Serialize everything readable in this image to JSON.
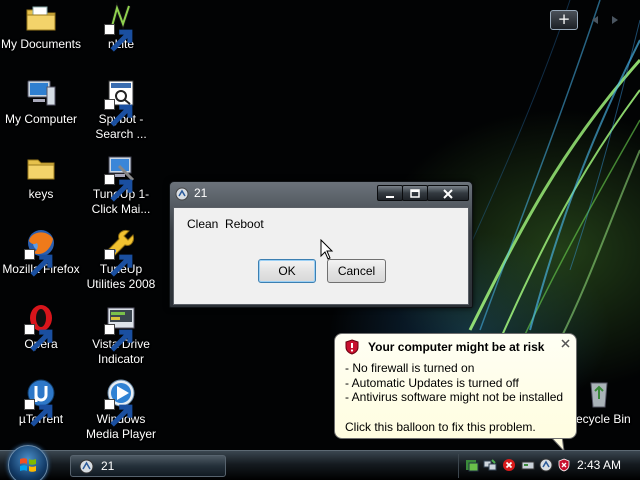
{
  "desktop": {
    "icons": [
      {
        "label": "My Documents",
        "icon": "folder-documents-icon"
      },
      {
        "label": "nLite",
        "icon": "nlite-icon",
        "shortcut": true
      },
      {
        "label": "My Computer",
        "icon": "computer-icon"
      },
      {
        "label": "Spybot - Search ...",
        "icon": "spybot-icon",
        "shortcut": true
      },
      {
        "label": "keys",
        "icon": "folder-icon"
      },
      {
        "label": "TuneUp 1-Click Mai...",
        "icon": "tuneup-1click-icon",
        "shortcut": true
      },
      {
        "label": "Mozilla Firefox",
        "icon": "firefox-icon",
        "shortcut": true
      },
      {
        "label": "TuneUp Utilities 2008",
        "icon": "tuneup-utilities-icon",
        "shortcut": true
      },
      {
        "label": "Opera",
        "icon": "opera-icon",
        "shortcut": true
      },
      {
        "label": "Vista Drive Indicator",
        "icon": "drive-indicator-icon",
        "shortcut": true
      },
      {
        "label": "µTorrent",
        "icon": "utorrent-icon",
        "shortcut": true
      },
      {
        "label": "Windows Media Player",
        "icon": "media-player-icon",
        "shortcut": true
      }
    ],
    "recycle_bin": {
      "label": "Recycle Bin",
      "icon": "recycle-bin-icon"
    }
  },
  "sidebar": {
    "add_label": "+",
    "icons": [
      "add-gadget-icon",
      "prev-arrow-icon",
      "next-arrow-icon"
    ]
  },
  "dialog": {
    "title": "21",
    "message": "Clean  Reboot",
    "ok_label": "OK",
    "cancel_label": "Cancel",
    "icons": [
      "app-icon",
      "minimize-icon",
      "maximize-icon",
      "close-icon"
    ]
  },
  "balloon": {
    "title": "Your computer might be at risk",
    "items": [
      "- No firewall is turned on",
      "- Automatic Updates is turned off",
      "- Antivirus software might not be installed"
    ],
    "footer": "Click this balloon to fix this problem.",
    "colors": {
      "shield": "#c8102e",
      "background": "#ffffe1"
    }
  },
  "taskbar": {
    "task_label": "21",
    "clock": "2:43 AM",
    "tray_icons": [
      "security-center-icon",
      "network-icon",
      "error-icon",
      "drive-icon",
      "app-tray-icon",
      "shield-warning-icon"
    ]
  }
}
